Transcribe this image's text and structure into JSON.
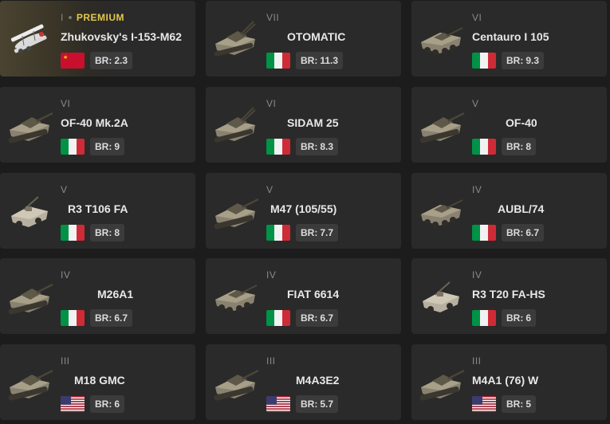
{
  "br_label": "BR:",
  "premium_label": "PREMIUM",
  "vehicles": [
    {
      "rank": "I",
      "premium": true,
      "name": "Zhukovsky's I-153-M62",
      "nation": "ussr",
      "br": "2.3",
      "type": "plane"
    },
    {
      "rank": "VII",
      "name": "OTOMATIC",
      "nation": "italy",
      "br": "11.3",
      "type": "spaa"
    },
    {
      "rank": "VI",
      "name": "Centauro I 105",
      "nation": "italy",
      "br": "9.3",
      "type": "wheeled"
    },
    {
      "rank": "VI",
      "name": "OF-40 Mk.2A",
      "nation": "italy",
      "br": "9",
      "type": "tank"
    },
    {
      "rank": "VI",
      "name": "SIDAM 25",
      "nation": "italy",
      "br": "8.3",
      "type": "spaa"
    },
    {
      "rank": "V",
      "name": "OF-40",
      "nation": "italy",
      "br": "8",
      "type": "tank"
    },
    {
      "rank": "V",
      "name": "R3 T106 FA",
      "nation": "italy",
      "br": "8",
      "type": "light"
    },
    {
      "rank": "V",
      "name": "M47 (105/55)",
      "nation": "italy",
      "br": "7.7",
      "type": "tank"
    },
    {
      "rank": "IV",
      "name": "AUBL/74",
      "nation": "italy",
      "br": "6.7",
      "type": "wheeled"
    },
    {
      "rank": "IV",
      "name": "M26A1",
      "nation": "italy",
      "br": "6.7",
      "type": "tank"
    },
    {
      "rank": "IV",
      "name": "FIAT 6614",
      "nation": "italy",
      "br": "6.7",
      "type": "wheeled"
    },
    {
      "rank": "IV",
      "name": "R3 T20 FA-HS",
      "nation": "italy",
      "br": "6",
      "type": "light"
    },
    {
      "rank": "III",
      "name": "M18 GMC",
      "nation": "usa",
      "br": "6",
      "type": "tank"
    },
    {
      "rank": "III",
      "name": "M4A3E2",
      "nation": "usa",
      "br": "5.7",
      "type": "tank"
    },
    {
      "rank": "III",
      "name": "M4A1 (76) W",
      "nation": "usa",
      "br": "5",
      "type": "tank"
    }
  ]
}
